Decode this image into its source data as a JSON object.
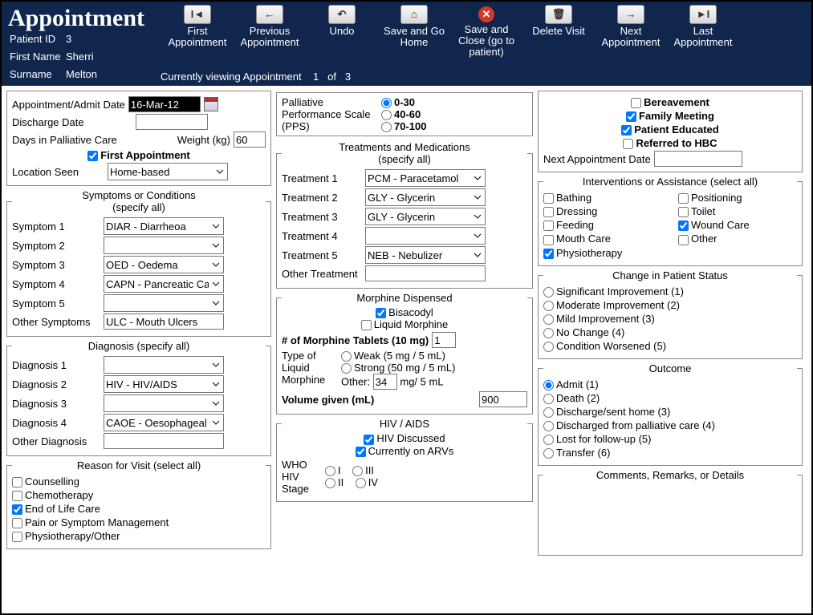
{
  "header": {
    "title": "Appointment",
    "patient_id_lbl": "Patient ID",
    "patient_id": "3",
    "first_name_lbl": "First Name",
    "first_name": "Sherri",
    "surname_lbl": "Surname",
    "surname": "Melton",
    "viewing": "Currently viewing Appointment",
    "idx": "1",
    "of": "of",
    "total": "3"
  },
  "toolbar": {
    "first": "First Appointment",
    "prev": "Previous Appointment",
    "undo": "Undo",
    "savehome": "Save and Go Home",
    "saveclose": "Save and Close (go to patient)",
    "delete": "Delete Visit",
    "next": "Next Appointment",
    "last": "Last Appointment"
  },
  "appt": {
    "admit_lbl": "Appointment/Admit Date",
    "admit_date": "16-Mar-12",
    "discharge_lbl": "Discharge Date",
    "discharge_date": "",
    "days_lbl": "Days in Palliative Care",
    "weight_lbl": "Weight (kg)",
    "weight": "60",
    "first_appt_lbl": "First Appointment",
    "location_lbl": "Location Seen",
    "location": "Home-based"
  },
  "symptoms": {
    "title": "Symptoms or Conditions\n(specify all)",
    "s1_lbl": "Symptom 1",
    "s1": "DIAR - Diarrheoa",
    "s2_lbl": "Symptom 2",
    "s2": "",
    "s3_lbl": "Symptom 3",
    "s3": "OED - Oedema",
    "s4_lbl": "Symptom 4",
    "s4": "CAPN - Pancreatic Cance",
    "s5_lbl": "Symptom 5",
    "s5": "",
    "other_lbl": "Other Symptoms",
    "other": "ULC - Mouth Ulcers"
  },
  "diagnosis": {
    "title": "Diagnosis (specify all)",
    "d1_lbl": "Diagnosis 1",
    "d1": "",
    "d2_lbl": "Diagnosis 2",
    "d2": "HIV - HIV/AIDS",
    "d3_lbl": "Diagnosis 3",
    "d3": "",
    "d4_lbl": "Diagnosis 4",
    "d4": "CAOE - Oesophageal Car",
    "other_lbl": "Other Diagnosis",
    "other": ""
  },
  "reason": {
    "title": "Reason for Visit (select all)",
    "r1": "Counselling",
    "r2": "Chemotherapy",
    "r3": "End of Life Care",
    "r4": "Pain or Symptom Management",
    "r5": "Physiotherapy/Other"
  },
  "pps": {
    "title": "Palliative Performance Scale (PPS)",
    "o1": "0-30",
    "o2": "40-60",
    "o3": "70-100"
  },
  "treatments": {
    "title": "Treatments and Medications\n(specify all)",
    "t1_lbl": "Treatment 1",
    "t1": "PCM - Paracetamol",
    "t2_lbl": "Treatment 2",
    "t2": "GLY - Glycerin",
    "t3_lbl": "Treatment 3",
    "t3": "GLY - Glycerin",
    "t4_lbl": "Treatment 4",
    "t4": "",
    "t5_lbl": "Treatment 5",
    "t5": "NEB - Nebulizer",
    "other_lbl": "Other Treatment",
    "other": ""
  },
  "morphine": {
    "title": "Morphine Dispensed",
    "c1": "Bisacodyl",
    "c2": "Liquid Morphine",
    "tabs_lbl": "# of Morphine Tablets (10 mg)",
    "tabs": "1",
    "type_lbl": "Type of Liquid Morphine",
    "weak": "Weak (5 mg / 5 mL)",
    "strong": "Strong (50 mg / 5 mL)",
    "other_lbl": "Other:",
    "other_val": "34",
    "other_unit": "mg/ 5 mL",
    "vol_lbl": "Volume given (mL)",
    "vol": "900"
  },
  "hiv": {
    "title": "HIV / AIDS",
    "c1": "HIV Discussed",
    "c2": "Currently on ARVs",
    "stage_lbl": "WHO HIV Stage",
    "s1": "I",
    "s2": "II",
    "s3": "III",
    "s4": "IV"
  },
  "right1": {
    "c1": "Bereavement",
    "c2": "Family Meeting",
    "c3": "Patient Educated",
    "c4": "Referred to HBC",
    "next_lbl": "Next Appointment Date"
  },
  "interv": {
    "title": "Interventions or Assistance (select all)",
    "i1": "Bathing",
    "i2": "Dressing",
    "i3": "Feeding",
    "i4": "Mouth Care",
    "i5": "Physiotherapy",
    "i6": "Positioning",
    "i7": "Toilet",
    "i8": "Wound Care",
    "i9": "Other"
  },
  "status": {
    "title": "Change in Patient Status",
    "s1": "Significant Improvement (1)",
    "s2": "Moderate Improvement (2)",
    "s3": "Mild Improvement (3)",
    "s4": "No Change (4)",
    "s5": "Condition Worsened (5)"
  },
  "outcome": {
    "title": "Outcome",
    "o1": "Admit (1)",
    "o2": "Death (2)",
    "o3": "Discharge/sent home (3)",
    "o4": "Discharged from palliative care (4)",
    "o5": "Lost for follow-up (5)",
    "o6": "Transfer (6)"
  },
  "comments": {
    "title": "Comments, Remarks, or Details"
  }
}
